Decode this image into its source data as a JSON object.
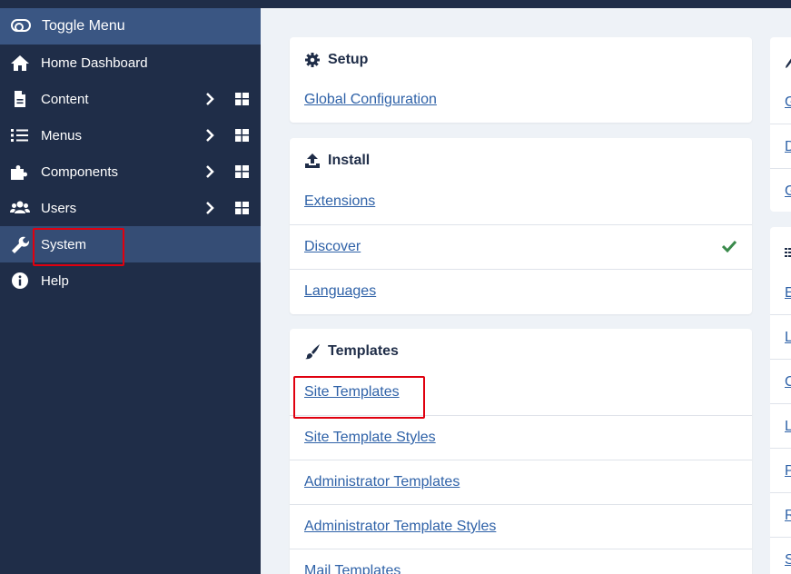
{
  "sidebar": {
    "toggle_label": "Toggle Menu",
    "items": [
      {
        "label": "Home Dashboard",
        "icon": "home-icon"
      },
      {
        "label": "Content",
        "icon": "file-icon"
      },
      {
        "label": "Menus",
        "icon": "list-icon"
      },
      {
        "label": "Components",
        "icon": "puzzle-icon"
      },
      {
        "label": "Users",
        "icon": "users-icon"
      },
      {
        "label": "System",
        "icon": "wrench-icon"
      },
      {
        "label": "Help",
        "icon": "info-icon"
      }
    ]
  },
  "cards": {
    "setup": {
      "title": "Setup",
      "links": [
        "Global Configuration"
      ]
    },
    "install": {
      "title": "Install",
      "links": [
        "Extensions",
        "Discover",
        "Languages"
      ]
    },
    "templates": {
      "title": "Templates",
      "links": [
        "Site Templates",
        "Site Template Styles",
        "Administrator Templates",
        "Administrator Template Styles",
        "Mail Templates"
      ]
    }
  },
  "right_column": {
    "card1_letters": [
      "G",
      "D",
      "G"
    ],
    "card2_letters": [
      "E",
      "L",
      "C",
      "L",
      "P",
      "R",
      "S"
    ]
  },
  "colors": {
    "sidebar_bg": "#1f2d48",
    "active_bg": "#354d75",
    "toggle_bg": "#3a5683",
    "link": "#2f62a8",
    "highlight": "#e0000f",
    "check": "#3a8a4b"
  }
}
